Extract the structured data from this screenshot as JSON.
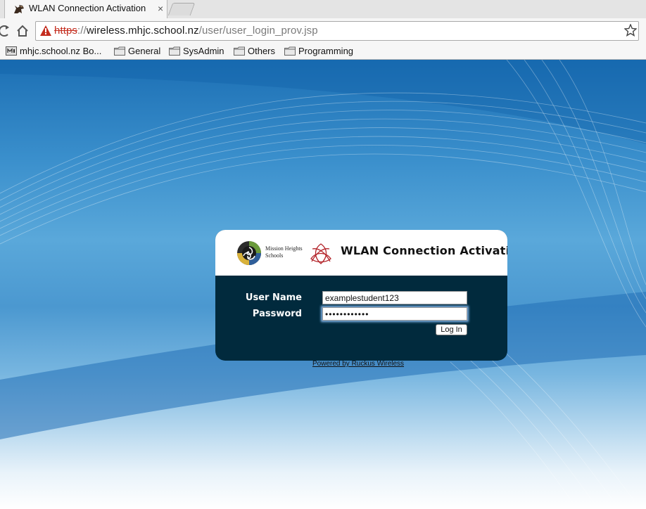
{
  "browser": {
    "tab": {
      "title": "WLAN Connection Activation",
      "close_glyph": "×"
    },
    "address_bar": {
      "scheme": "https",
      "separator": "://",
      "host": "wireless.mhjc.school.nz",
      "path": "/user/user_login_prov.jsp"
    },
    "bookmarks": [
      {
        "label": "mhjc.school.nz Bo...",
        "icon": "site-favicon"
      },
      {
        "label": "General",
        "icon": "folder-icon"
      },
      {
        "label": "SysAdmin",
        "icon": "folder-icon"
      },
      {
        "label": "Others",
        "icon": "folder-icon"
      },
      {
        "label": "Programming",
        "icon": "folder-icon"
      }
    ]
  },
  "login": {
    "school_name": "Mission Heights Schools",
    "title": "WLAN Connection Activation",
    "username_label": "User Name",
    "username_value": "examplestudent123",
    "password_label": "Password",
    "password_value": "••••••••••••",
    "login_button": "Log In"
  },
  "footer": {
    "powered_by": "Powered by Ruckus Wireless"
  },
  "colors": {
    "card_bg": "#012a3d",
    "insecure_scheme": "#c42d1f",
    "page_blue": "#3a8fcc"
  }
}
